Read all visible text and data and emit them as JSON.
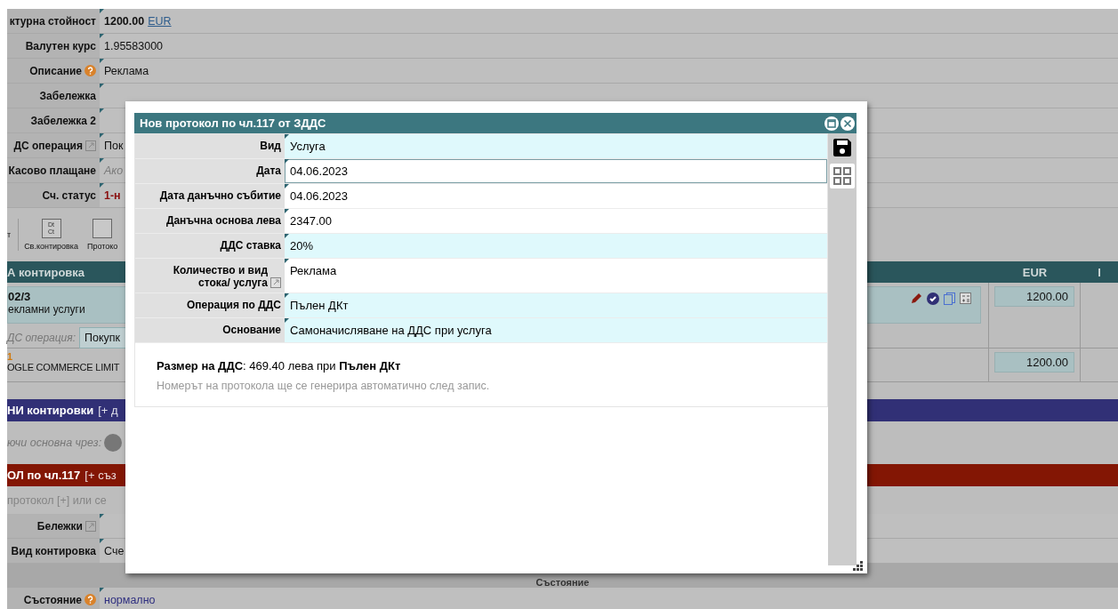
{
  "fields_top": [
    {
      "label": "ктурна стойност",
      "help": false,
      "external": false,
      "value": "1200.00",
      "kind": "amount",
      "unit": "EUR"
    },
    {
      "label": "Валутен курс",
      "help": false,
      "external": false,
      "value": "1.95583000",
      "kind": "text"
    },
    {
      "label": "Описание",
      "help": true,
      "external": false,
      "value": "Реклама",
      "kind": "text"
    },
    {
      "label": "Забележка",
      "help": false,
      "external": false,
      "kind": "text"
    },
    {
      "label": "Забележка 2",
      "help": false,
      "external": false,
      "kind": "text"
    },
    {
      "label": "ДС операция",
      "help": false,
      "external": true,
      "value": "Пок",
      "kind": "text"
    },
    {
      "label": "Касово плащане",
      "help": false,
      "external": false,
      "placeholder": "Ако",
      "kind": "text"
    },
    {
      "label": "Сч. статус",
      "help": false,
      "external": false,
      "value": "1-н",
      "kind": "status"
    }
  ],
  "toolbar": [
    {
      "label": "т",
      "separator": true
    },
    {
      "label": "Св.контировка",
      "icon_text": [
        "Dt",
        "Ct"
      ],
      "separator": false
    },
    {
      "label": "Протоко",
      "separator": false
    }
  ],
  "table": {
    "columns": [
      "А контировка",
      "EUR",
      "I"
    ],
    "rows": [
      {
        "code": "02/3",
        "name": "екламни услуги",
        "op_label": "ДС операция:",
        "op_value": "Покупк",
        "amount": "1200.00",
        "kind": "account"
      },
      {
        "code": "1",
        "name": "OGLE COMMERCE LIMIT",
        "amount": "1200.00",
        "kind": "partner"
      }
    ]
  },
  "sections": [
    {
      "title": "НИ контировки",
      "action": "[+ д",
      "hint": "ючи основна чрез:",
      "color": "#313076",
      "kind": "button"
    },
    {
      "title": "ОЛ по чл.117",
      "action": "[+ съз",
      "hint": "протокол [+] или се",
      "color": "#831604",
      "kind": "text"
    }
  ],
  "fields_bottom": [
    {
      "label": "Бележки",
      "help": false,
      "external": true,
      "kind": "text"
    },
    {
      "label": "Вид контировка",
      "help": false,
      "external": false,
      "value": "Сче",
      "kind": "text"
    }
  ],
  "state_heading": "Състояние",
  "state_field": {
    "label": "Състояние",
    "help": true,
    "external": false,
    "value": "нормално",
    "kind": "link"
  },
  "dialog": {
    "title": "Нов протокол по чл.117 от ЗДДС",
    "rows": [
      {
        "label": "Вид",
        "external": false,
        "value": "Услуга",
        "kind": "select",
        "focused": false
      },
      {
        "label": "Дата",
        "external": false,
        "value": "04.06.2023",
        "kind": "text",
        "focused": true
      },
      {
        "label": "Дата данъчно събитие",
        "external": false,
        "value": "04.06.2023",
        "kind": "text",
        "focused": false
      },
      {
        "label": "Данъчна основа лева",
        "external": false,
        "value": "2347.00",
        "kind": "text",
        "focused": false
      },
      {
        "label": "ДДС ставка",
        "external": false,
        "value": "20%",
        "kind": "select",
        "focused": false
      },
      {
        "label": "Количество и вид стока/ услуга",
        "external": true,
        "value": "Реклама",
        "kind": "text",
        "focused": false
      },
      {
        "label": "Операция по ДДС",
        "external": false,
        "value": "Пълен ДКт",
        "kind": "select",
        "focused": false
      },
      {
        "label": "Основание",
        "external": false,
        "value": "Самоначисляване на ДДС при услуга",
        "kind": "select",
        "focused": false
      }
    ],
    "summary": "**Размер на ДДС**: 469.40 лева при **Пълен ДКт**",
    "note": "Номерът на протокола ще се генерира автоматично след запис."
  }
}
